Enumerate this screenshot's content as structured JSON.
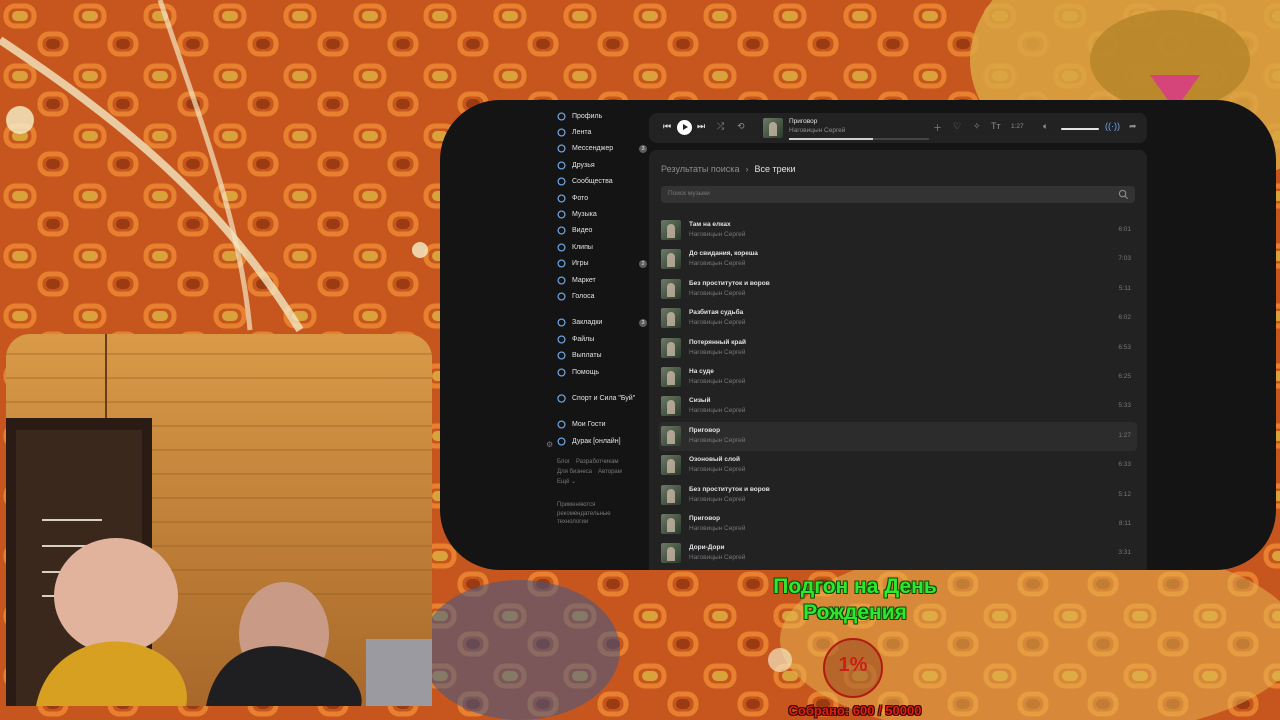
{
  "sidebar": {
    "items": [
      {
        "label": "Профиль",
        "icon": "profile-icon"
      },
      {
        "label": "Лента",
        "icon": "news-icon"
      },
      {
        "label": "Мессенджер",
        "icon": "message-icon",
        "badge": "3"
      },
      {
        "label": "Друзья",
        "icon": "friends-icon"
      },
      {
        "label": "Сообщества",
        "icon": "groups-icon"
      },
      {
        "label": "Фото",
        "icon": "photo-icon"
      },
      {
        "label": "Музыка",
        "icon": "music-icon"
      },
      {
        "label": "Видео",
        "icon": "video-icon"
      },
      {
        "label": "Клипы",
        "icon": "clips-icon"
      },
      {
        "label": "Игры",
        "icon": "games-icon",
        "badge": "2"
      },
      {
        "label": "Маркет",
        "icon": "market-icon"
      },
      {
        "label": "Голоса",
        "icon": "votes-icon"
      }
    ],
    "items2": [
      {
        "label": "Закладки",
        "icon": "bookmark-icon",
        "badge": "3"
      },
      {
        "label": "Файлы",
        "icon": "files-icon"
      },
      {
        "label": "Выплаты",
        "icon": "payments-icon"
      },
      {
        "label": "Помощь",
        "icon": "help-icon"
      }
    ],
    "community": "Спорт и Сила \"Буй\"",
    "apps": [
      {
        "label": "Мои Гости",
        "icon": "apps-icon"
      },
      {
        "label": "Дурак [онлайн]",
        "icon": "gamepad-icon"
      }
    ],
    "footer": {
      "blog": "Блог",
      "devs": "Разработчикам",
      "business": "Для бизнеса",
      "authors": "Авторам",
      "more": "Ещё ⌄"
    },
    "note": "Применяются рекомендательные технологии"
  },
  "player": {
    "title": "Приговор",
    "artist": "Наговицын Сергей",
    "time": "1:27",
    "progress": 0.6
  },
  "breadcrumb": {
    "parent": "Результаты поиска",
    "current": "Все треки"
  },
  "search": {
    "placeholder": "Поиск музыки"
  },
  "tracks": [
    {
      "title": "Там на елках",
      "artist": "Наговицын Сергей",
      "duration": "6:01"
    },
    {
      "title": "До свидания, кореша",
      "artist": "Наговицын Сергей",
      "duration": "7:03"
    },
    {
      "title": "Без проституток и воров",
      "artist": "Наговицын Сергей",
      "duration": "5:11"
    },
    {
      "title": "Разбитая судьба",
      "artist": "Наговицын Сергей",
      "duration": "6:02"
    },
    {
      "title": "Потерянный край",
      "artist": "Наговицын Сергей",
      "duration": "6:53"
    },
    {
      "title": "На суде",
      "artist": "Наговицын Сергей",
      "duration": "6:25"
    },
    {
      "title": "Сизый",
      "artist": "Наговицын Сергей",
      "duration": "5:33"
    },
    {
      "title": "Приговор",
      "artist": "Наговицын Сергей",
      "duration": "1:27",
      "active": true
    },
    {
      "title": "Озоновый слой",
      "artist": "Наговицын Сергей",
      "duration": "6:33"
    },
    {
      "title": "Без проституток и воров",
      "artist": "Наговицын Сергей",
      "duration": "5:12"
    },
    {
      "title": "Приговор",
      "artist": "Наговицын Сергей",
      "duration": "8:11"
    },
    {
      "title": "Дори-Дори",
      "artist": "Наговицын Сергей",
      "duration": "3:31"
    }
  ],
  "donation": {
    "title": "Подгон на День Рождения",
    "percent": "1%",
    "collected": "Собрано: 600 / 50000"
  },
  "colors": {
    "accent": "#71aaeb",
    "window_bg": "#141414",
    "panel_bg": "#222222",
    "donation_green": "#2ee82e",
    "donation_red": "#e21d12"
  }
}
